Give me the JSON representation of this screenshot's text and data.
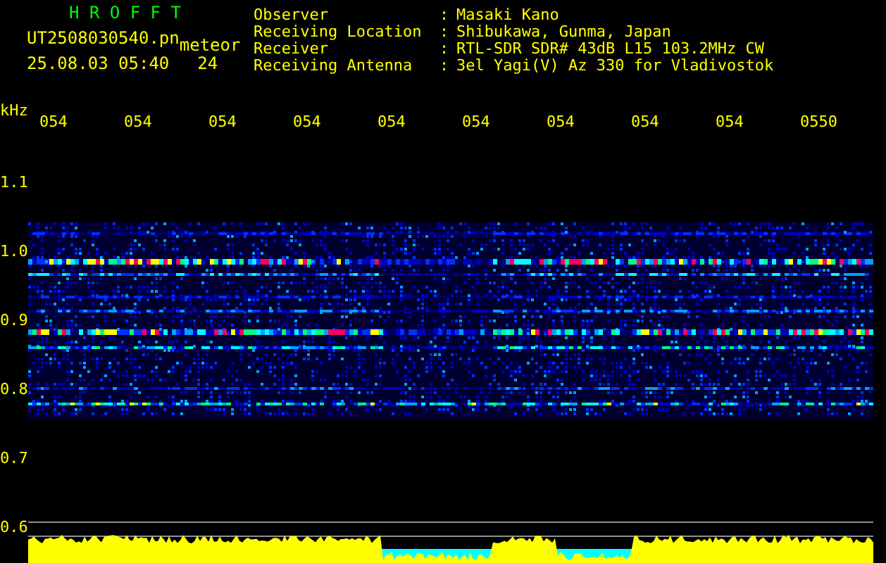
{
  "header": {
    "title": "H R O F F T",
    "file_name": "UT2508030540.pn",
    "tag": "meteor",
    "date_time": "25.08.03 05:40",
    "count": "24"
  },
  "info": [
    {
      "label": "Observer",
      "separator": ":",
      "value": "Masaki Kano"
    },
    {
      "label": "Receiving Location",
      "separator": ":",
      "value": "Shibukawa, Gunma, Japan"
    },
    {
      "label": "Receiver",
      "separator": ":",
      "value": "RTL-SDR SDR# 43dB L15 103.2MHz CW"
    },
    {
      "label": "Receiving Antenna",
      "separator": ":",
      "value": "3el Yagi(V) Az 330 for Vladivostok"
    }
  ],
  "axis": {
    "unit": "kHz",
    "y_labels": [
      "1.1",
      "1.0",
      "0.9",
      "0.8",
      "0.7",
      "0.6"
    ]
  },
  "time_labels": [
    "054",
    "054",
    "054",
    "054",
    "054",
    "054",
    "054",
    "054",
    "054",
    "0550"
  ]
}
